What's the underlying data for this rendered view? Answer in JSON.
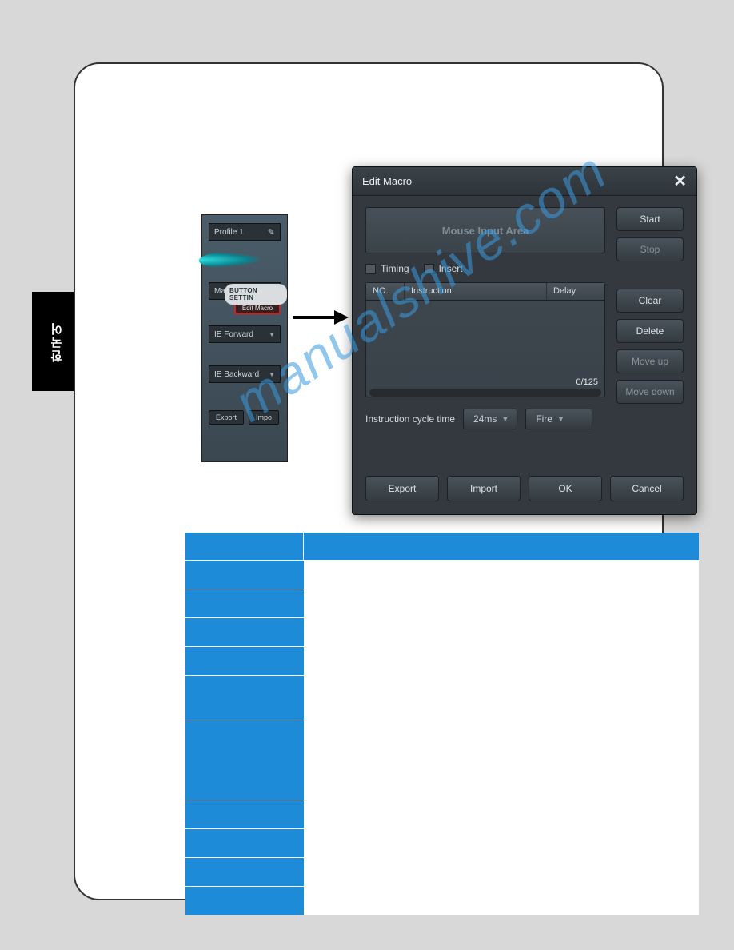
{
  "sideTab": "한국어",
  "swatch": {
    "profile": "Profile 1",
    "sectionLabel": "BUTTON SETTIN",
    "selects": {
      "macro": "Macro",
      "fwd": "IE Forward",
      "back": "IE Backward"
    },
    "editMacro": "Edit Macro",
    "buttons": {
      "export": "Export",
      "import": "Impo"
    }
  },
  "dialog": {
    "title": "Edit Macro",
    "mouseArea": "Mouse Input Area",
    "checks": {
      "timing": "Timing",
      "insert": "Insert"
    },
    "headers": {
      "no": "NO.",
      "instruction": "Instruction",
      "delay": "Delay"
    },
    "count": "0/125",
    "sideButtons": {
      "start": "Start",
      "stop": "Stop",
      "clear": "Clear",
      "delete": "Delete",
      "moveUp": "Move up",
      "moveDown": "Move down"
    },
    "cycleLabel": "Instruction cycle time",
    "cycleValue": "24ms",
    "fireValue": "Fire",
    "foot": {
      "export": "Export",
      "import": "Import",
      "ok": "OK",
      "cancel": "Cancel"
    }
  },
  "watermark": "manualshive.com"
}
